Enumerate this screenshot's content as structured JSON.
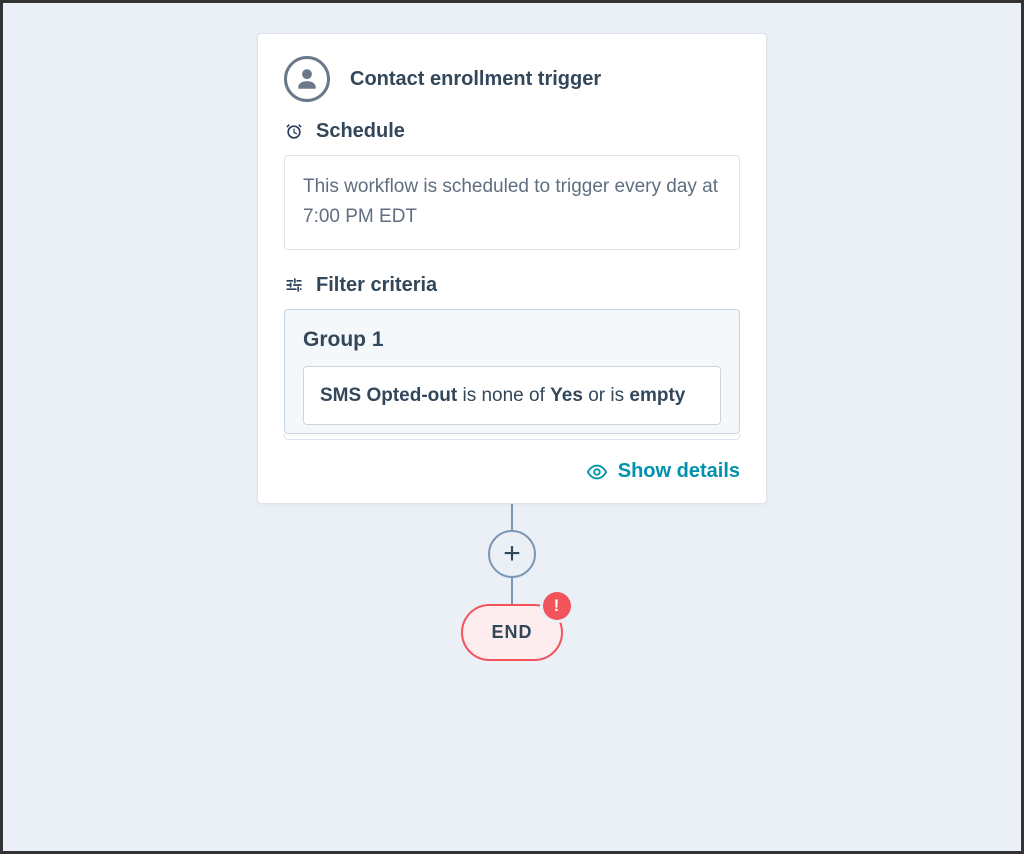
{
  "trigger_card": {
    "title": "Contact enrollment trigger",
    "schedule": {
      "label": "Schedule",
      "text": "This workflow is scheduled to trigger every day at 7:00 PM EDT"
    },
    "filter": {
      "label": "Filter criteria",
      "group_title": "Group 1",
      "criteria_html": "<b>SMS Opted-out</b> is none of <b>Yes</b> or is <b>empty</b>"
    },
    "footer": {
      "show_details": "Show details"
    }
  },
  "flow": {
    "add_symbol": "+",
    "end_label": "END",
    "alert_symbol": "!"
  }
}
